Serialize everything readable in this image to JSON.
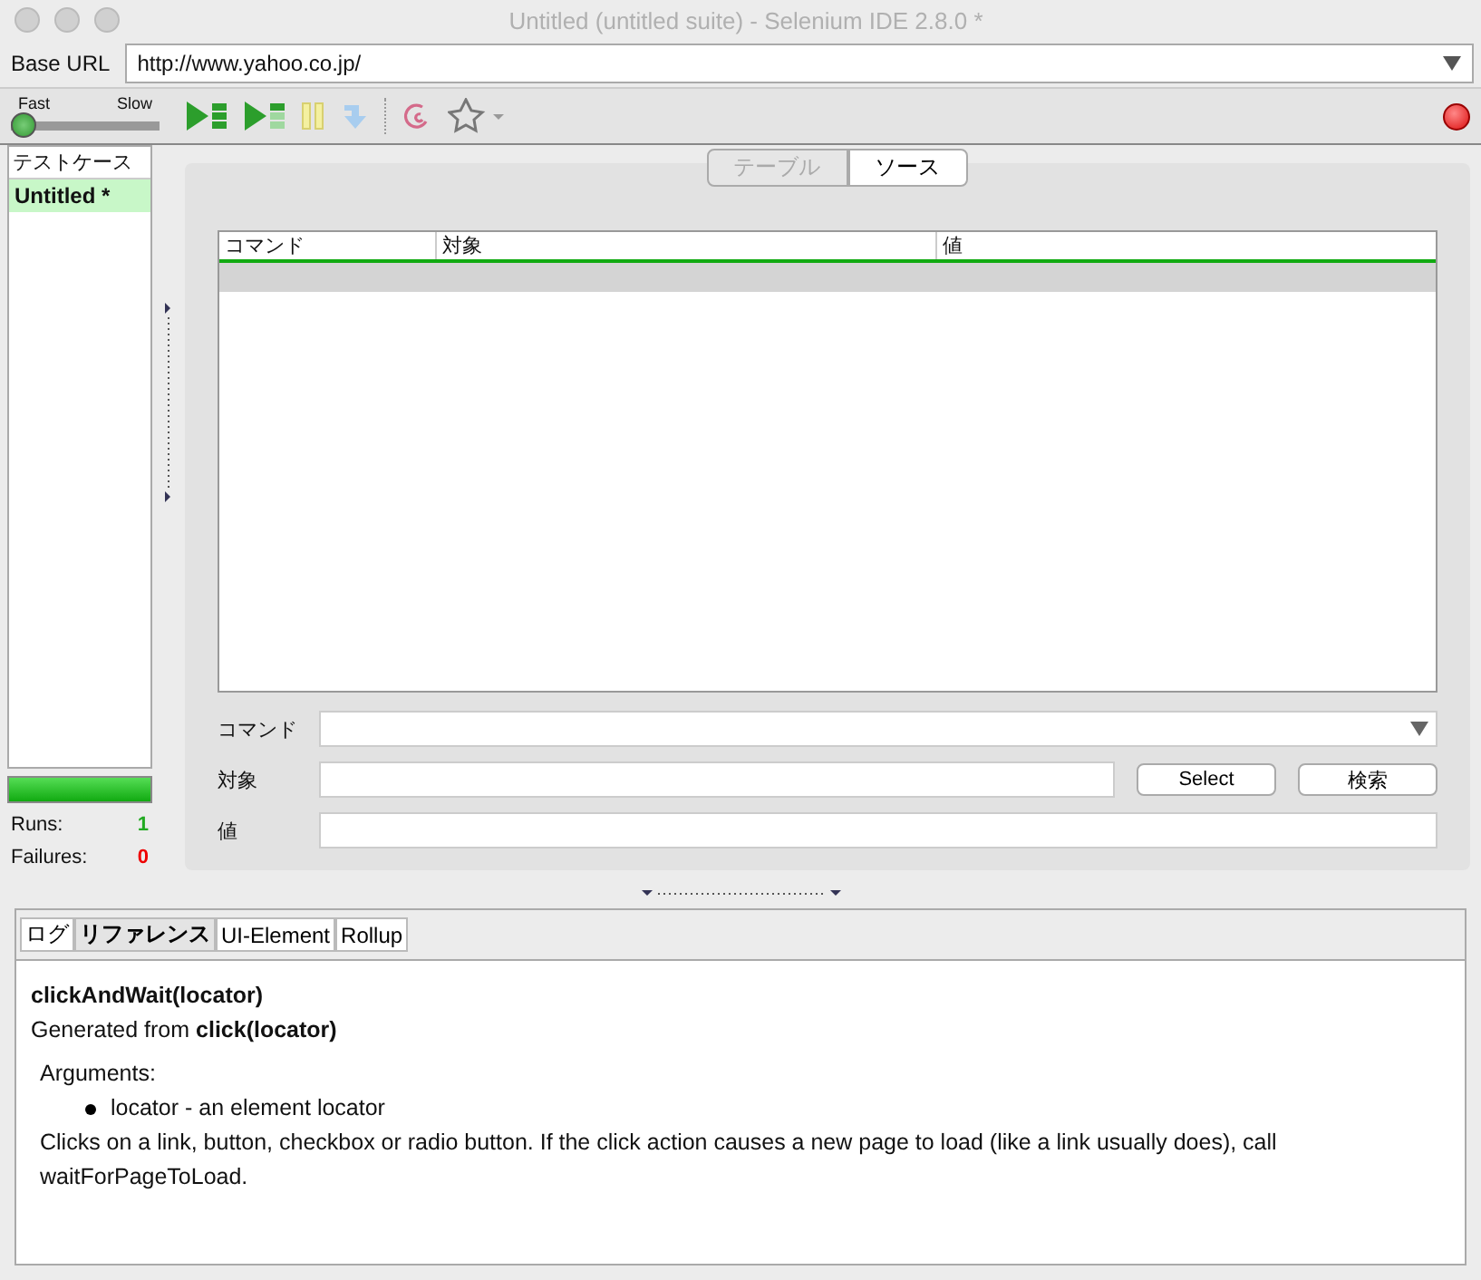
{
  "window": {
    "title": "Untitled (untitled suite) - Selenium IDE 2.8.0 *"
  },
  "base_url": {
    "label": "Base URL",
    "value": "http://www.yahoo.co.jp/"
  },
  "speed": {
    "fast_label": "Fast",
    "slow_label": "Slow",
    "level": 0
  },
  "toolbar": [
    {
      "kind": "play-all"
    },
    {
      "kind": "play-one"
    },
    {
      "kind": "pause"
    },
    {
      "kind": "step"
    },
    {
      "kind": "swirl"
    },
    {
      "kind": "star"
    }
  ],
  "recording": true,
  "test_cases": {
    "header": "テストケース",
    "items": [
      {
        "label": "Untitled *",
        "selected": true
      }
    ]
  },
  "progress": {
    "level": 1
  },
  "stats": [
    {
      "label": "Runs:",
      "value": "1",
      "kind": "pass"
    },
    {
      "label": "Failures:",
      "value": "0",
      "kind": "fail"
    }
  ],
  "editor_tabs": [
    {
      "label": "テーブル",
      "selected": false
    },
    {
      "label": "ソース",
      "selected": true
    }
  ],
  "table": {
    "columns": [
      "コマンド",
      "対象",
      "値"
    ]
  },
  "form": {
    "command_label": "コマンド",
    "target_label": "対象",
    "value_label": "値",
    "select_button": "Select",
    "find_button": "検索"
  },
  "bottom_tabs": [
    {
      "label": "ログ",
      "selected": false
    },
    {
      "label": "リファレンス",
      "selected": true
    },
    {
      "label": "UI-Element",
      "selected": false
    },
    {
      "label": "Rollup",
      "selected": false
    }
  ],
  "reference": {
    "title": "clickAndWait(locator)",
    "generated": "Generated from **click(locator)**",
    "arguments_label": "Arguments:",
    "arguments": [
      "locator - an element locator"
    ],
    "description": "Clicks on a link, button, checkbox or radio button. If the click action causes a new page to load (like a link usually does), call waitForPageToLoad."
  }
}
